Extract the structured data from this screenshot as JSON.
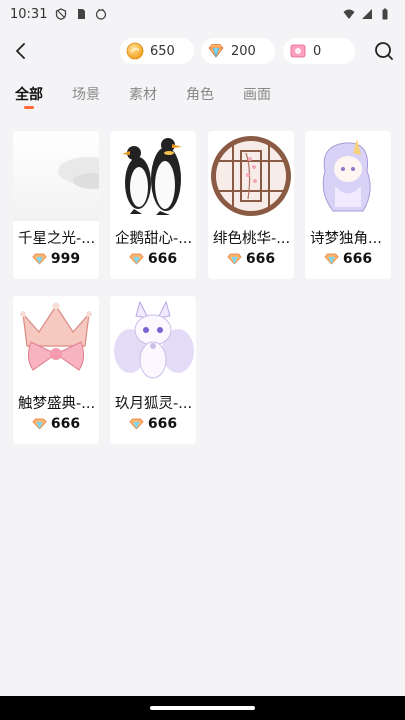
{
  "status": {
    "time": "10:31"
  },
  "currency": {
    "coins": "650",
    "gems": "200",
    "tickets": "0"
  },
  "tabs": [
    {
      "label": "全部"
    },
    {
      "label": "场景"
    },
    {
      "label": "素材"
    },
    {
      "label": "角色"
    },
    {
      "label": "画面"
    }
  ],
  "items": [
    {
      "name": "千星之光-...",
      "price": "999",
      "icon": "snowy-landscape-art"
    },
    {
      "name": "企鹅甜心-...",
      "price": "666",
      "icon": "penguins-art"
    },
    {
      "name": "绯色桃华-...",
      "price": "666",
      "icon": "round-window-art"
    },
    {
      "name": "诗梦独角...",
      "price": "666",
      "icon": "unicorn-girl-art"
    },
    {
      "name": "触梦盛典-...",
      "price": "666",
      "icon": "crown-bow-art"
    },
    {
      "name": "玖月狐灵-...",
      "price": "666",
      "icon": "white-fox-art"
    }
  ],
  "colors": {
    "accent": "#ff6a3d",
    "background": "#f4f4f7"
  }
}
